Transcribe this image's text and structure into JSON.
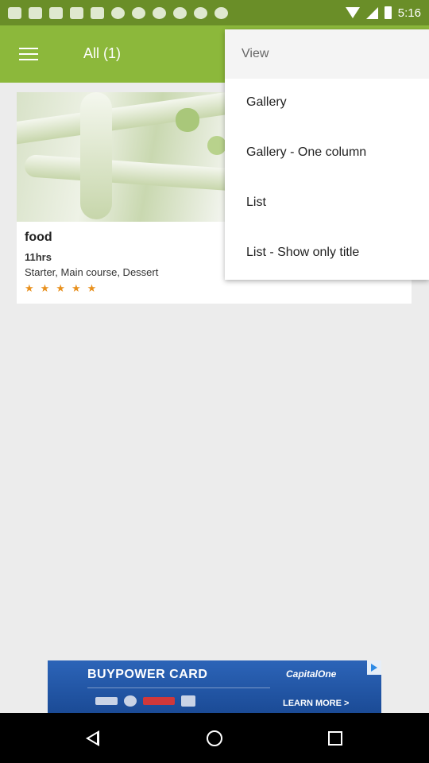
{
  "status_bar": {
    "time": "5:16",
    "notification_icons": [
      "cat-face-icon",
      "esc-app-icon",
      "cat-face-icon",
      "cat-face-icon",
      "cat-face-icon",
      "pinterest-icon",
      "pinterest-icon",
      "pinterest-icon",
      "pinterest-icon",
      "pinterest-icon",
      "pinterest-icon"
    ]
  },
  "app_bar": {
    "title": "All (1)",
    "background_color": "#8cb83b"
  },
  "recipe_card": {
    "title": "food",
    "time": "11hrs",
    "categories": "Starter, Main course, Dessert",
    "rating_stars": 5,
    "star_color": "#e8901d",
    "star_glyph": "★"
  },
  "view_menu": {
    "header": "View",
    "items": [
      {
        "label": "Gallery"
      },
      {
        "label": "Gallery - One column"
      },
      {
        "label": "List"
      },
      {
        "label": "List - Show only title"
      }
    ]
  },
  "ad_banner": {
    "title": "BUYPOWER CARD",
    "brand": "CapitalOne",
    "cta": "LEARN MORE >"
  },
  "nav_bar": {
    "icons": [
      "back-icon",
      "home-icon",
      "recent-apps-icon"
    ]
  }
}
